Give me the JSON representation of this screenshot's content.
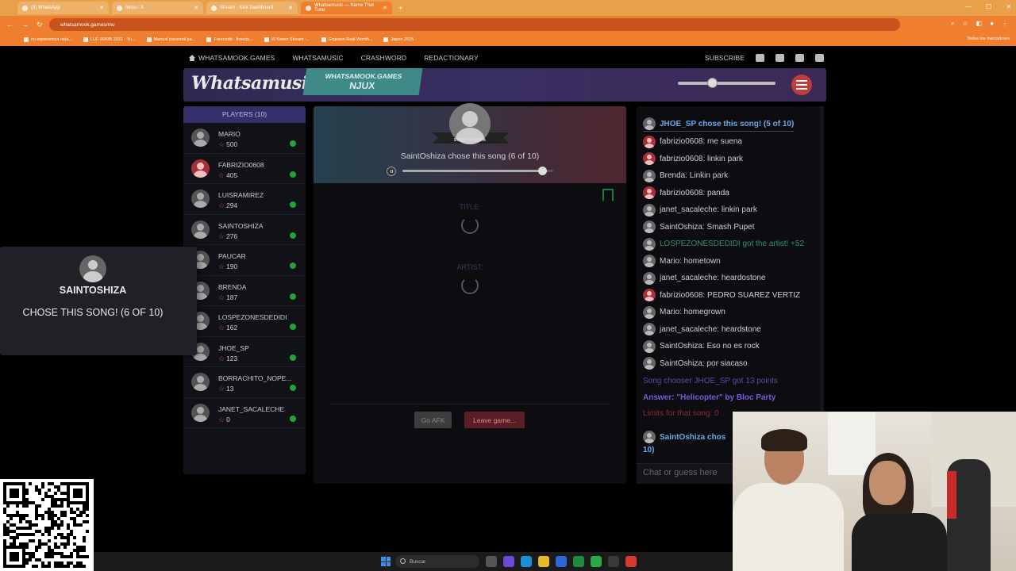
{
  "browser": {
    "tabs": [
      {
        "label": "(8) WhatsApp",
        "active": false
      },
      {
        "label": "Inicio / X",
        "active": false
      },
      {
        "label": "Stream - Kick Dashboard",
        "active": false
      },
      {
        "label": "Whatsamusic — Name That Tune",
        "active": true
      }
    ],
    "url": "whatsamook.games/mu",
    "bookmarks": [
      "mi experiencia nela...",
      "LUF 90435 2021 - Yo...",
      "Manual personal pa...",
      "Freecodd - freects...",
      "W Kiwen Stream -...",
      "Grgeson Real Worsh...",
      "Japon 2025"
    ],
    "bookmarks_right": "Todos los marcadores"
  },
  "sitenav": {
    "home": "WHATSAMOOK.GAMES",
    "links": [
      "WHATSAMUSIC",
      "CRASHWORD",
      "REDACTIONARY"
    ],
    "subscribe": "SUBSCRIBE"
  },
  "header": {
    "logo": "Whatsamusic",
    "badge_line1": "WHATSAMOOK.GAMES",
    "badge_line2": "NJUX",
    "volume": 0.35
  },
  "players": {
    "title": "PLAYERS (10)",
    "list": [
      {
        "name": "MARIO",
        "score": "500",
        "red": false
      },
      {
        "name": "FABRIZIO0608",
        "score": "405",
        "red": true
      },
      {
        "name": "LUISRAMIREZ",
        "score": "294",
        "red": false
      },
      {
        "name": "SAINTOSHIZA",
        "score": "276",
        "red": false
      },
      {
        "name": "PAUCAR",
        "score": "190",
        "red": false
      },
      {
        "name": "BRENDA",
        "score": "187",
        "red": false
      },
      {
        "name": "LOSPEZONESDEDIDI",
        "score": "162",
        "red": false
      },
      {
        "name": "JHOE_SP",
        "score": "123",
        "red": false
      },
      {
        "name": "BORRACHITO_NOPE...",
        "score": "13",
        "red": false
      },
      {
        "name": "JANET_SACALECHE",
        "score": "0",
        "red": false
      }
    ]
  },
  "overlay": {
    "name": "SAINTOSHIZA",
    "text": "CHOSE THIS SONG! (6 OF 10)"
  },
  "round": {
    "chooser": "SAINTOSHIZA",
    "status": "SaintOshiza chose this song (6 of 10)",
    "progress": 0.93,
    "title_label": "TITLE:",
    "artist_label": "ARTIST:",
    "afk_button": "Go AFK",
    "leave_button": "Leave game..."
  },
  "chat": {
    "messages": [
      {
        "text": "JHOE_SP chose this song! (5 of 10)",
        "style": "first",
        "red": false
      },
      {
        "text": "fabrizio0608: me suena",
        "style": "",
        "red": true
      },
      {
        "text": "fabrizio0608: linkin park",
        "style": "",
        "red": true
      },
      {
        "text": "Brenda: Linkin park",
        "style": "",
        "red": false
      },
      {
        "text": "fabrizio0608: panda",
        "style": "",
        "red": true
      },
      {
        "text": "janet_sacaleche: linkin park",
        "style": "",
        "red": false
      },
      {
        "text": "SaintOshiza: Smash Pupet",
        "style": "",
        "red": false
      },
      {
        "text": "LOSPEZONESDEDIDI got the artist! +52",
        "style": "green",
        "red": false
      },
      {
        "text": "Mario: hometown",
        "style": "",
        "red": false
      },
      {
        "text": "janet_sacaleche: heardostone",
        "style": "",
        "red": false
      },
      {
        "text": "fabrizio0608: PEDRO SUAREZ VERTIZ",
        "style": "",
        "red": true
      },
      {
        "text": "Mario: homegrown",
        "style": "",
        "red": false
      },
      {
        "text": "janet_sacaleche: heardstone",
        "style": "",
        "red": false
      },
      {
        "text": "SaintOshiza: Eso no es rock",
        "style": "",
        "red": false
      },
      {
        "text": "SaintOshiza: por siacaso",
        "style": "",
        "red": false
      }
    ],
    "system": [
      {
        "text": "Song chooser JHOE_SP got 13 points",
        "color": "#5a4aa8"
      },
      {
        "text": "Answer: \"Helicopter\" by Bloc Party",
        "color": "#7b5ad6"
      },
      {
        "text": "Limits for that song: 0",
        "color": "#8a2a35"
      }
    ],
    "last_line1": "SaintOshiza chos",
    "last_line2": "10)",
    "input_placeholder": "Chat or guess here"
  },
  "taskbar": {
    "search": "Buscar"
  },
  "colors": {
    "accent_purple": "#36306a",
    "teal_badge": "#3f8a86",
    "online": "#1fa33a",
    "menu_red": "#c23c3c"
  }
}
